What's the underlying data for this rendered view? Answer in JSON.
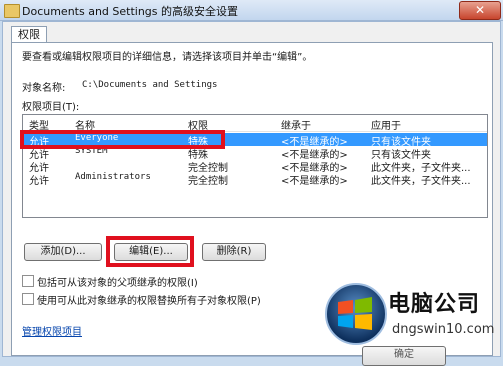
{
  "window": {
    "title": "Documents and Settings 的高级安全设置",
    "close_symbol": "✕"
  },
  "tab": {
    "label": "权限"
  },
  "panel": {
    "intro": "要查看或编辑权限项目的详细信息，请选择该项目并单击“编辑”。",
    "object_label": "对象名称:",
    "object_value": "C:\\Documents and Settings",
    "entries_label": "权限项目(T):"
  },
  "table": {
    "columns": [
      "类型",
      "名称",
      "权限",
      "继承于",
      "应用于"
    ],
    "rows": [
      {
        "type": "允许",
        "name": "Everyone",
        "permission": "特殊",
        "inherited": "<不是继承的>",
        "applies": "只有该文件夹",
        "selected": true
      },
      {
        "type": "允许",
        "name": "SYSTEM",
        "permission": "特殊",
        "inherited": "<不是继承的>",
        "applies": "只有该文件夹",
        "selected": false
      },
      {
        "type": "允许",
        "name": "",
        "permission": "完全控制",
        "inherited": "<不是继承的>",
        "applies": "此文件夹，子文件夹...",
        "selected": false
      },
      {
        "type": "允许",
        "name": "Administrators",
        "permission": "完全控制",
        "inherited": "<不是继承的>",
        "applies": "此文件夹，子文件夹...",
        "selected": false
      }
    ]
  },
  "buttons": {
    "add": "添加(D)...",
    "edit": "编辑(E)...",
    "remove": "删除(R)",
    "ok": "确定"
  },
  "checkboxes": {
    "inherit": "包括可从该对象的父项继承的权限(I)",
    "replace": "使用可从此对象继承的权限替换所有子对象权限(P)"
  },
  "link": "管理权限项目",
  "watermark": {
    "title": "电脑公司",
    "url": "dngswin10.com"
  },
  "colors": {
    "selection": "#3399ff",
    "highlight_box": "#e0101e",
    "link": "#0645ad"
  }
}
